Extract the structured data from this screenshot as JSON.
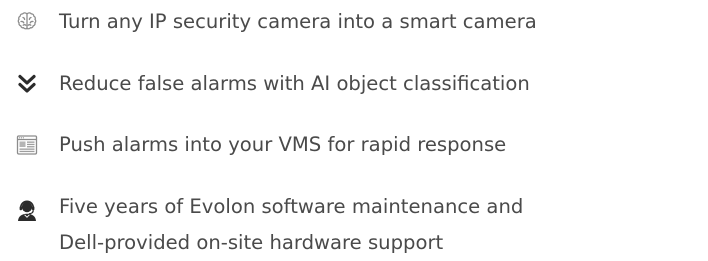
{
  "features": [
    {
      "icon": "brain-icon",
      "lines": [
        "Turn any IP security camera into a smart camera"
      ]
    },
    {
      "icon": "double-chevron-down-icon",
      "lines": [
        "Reduce false alarms with AI object classification"
      ]
    },
    {
      "icon": "vms-dashboard-icon",
      "lines": [
        "Push alarms into your VMS for rapid response"
      ]
    },
    {
      "icon": "support-agent-icon",
      "lines": [
        "Five years of Evolon software maintenance and",
        "Dell-provided on-site hardware support"
      ]
    }
  ],
  "colors": {
    "text": "#4a4a4a",
    "icon_light": "#8c8c8c",
    "icon_dark": "#2b2b2b"
  }
}
